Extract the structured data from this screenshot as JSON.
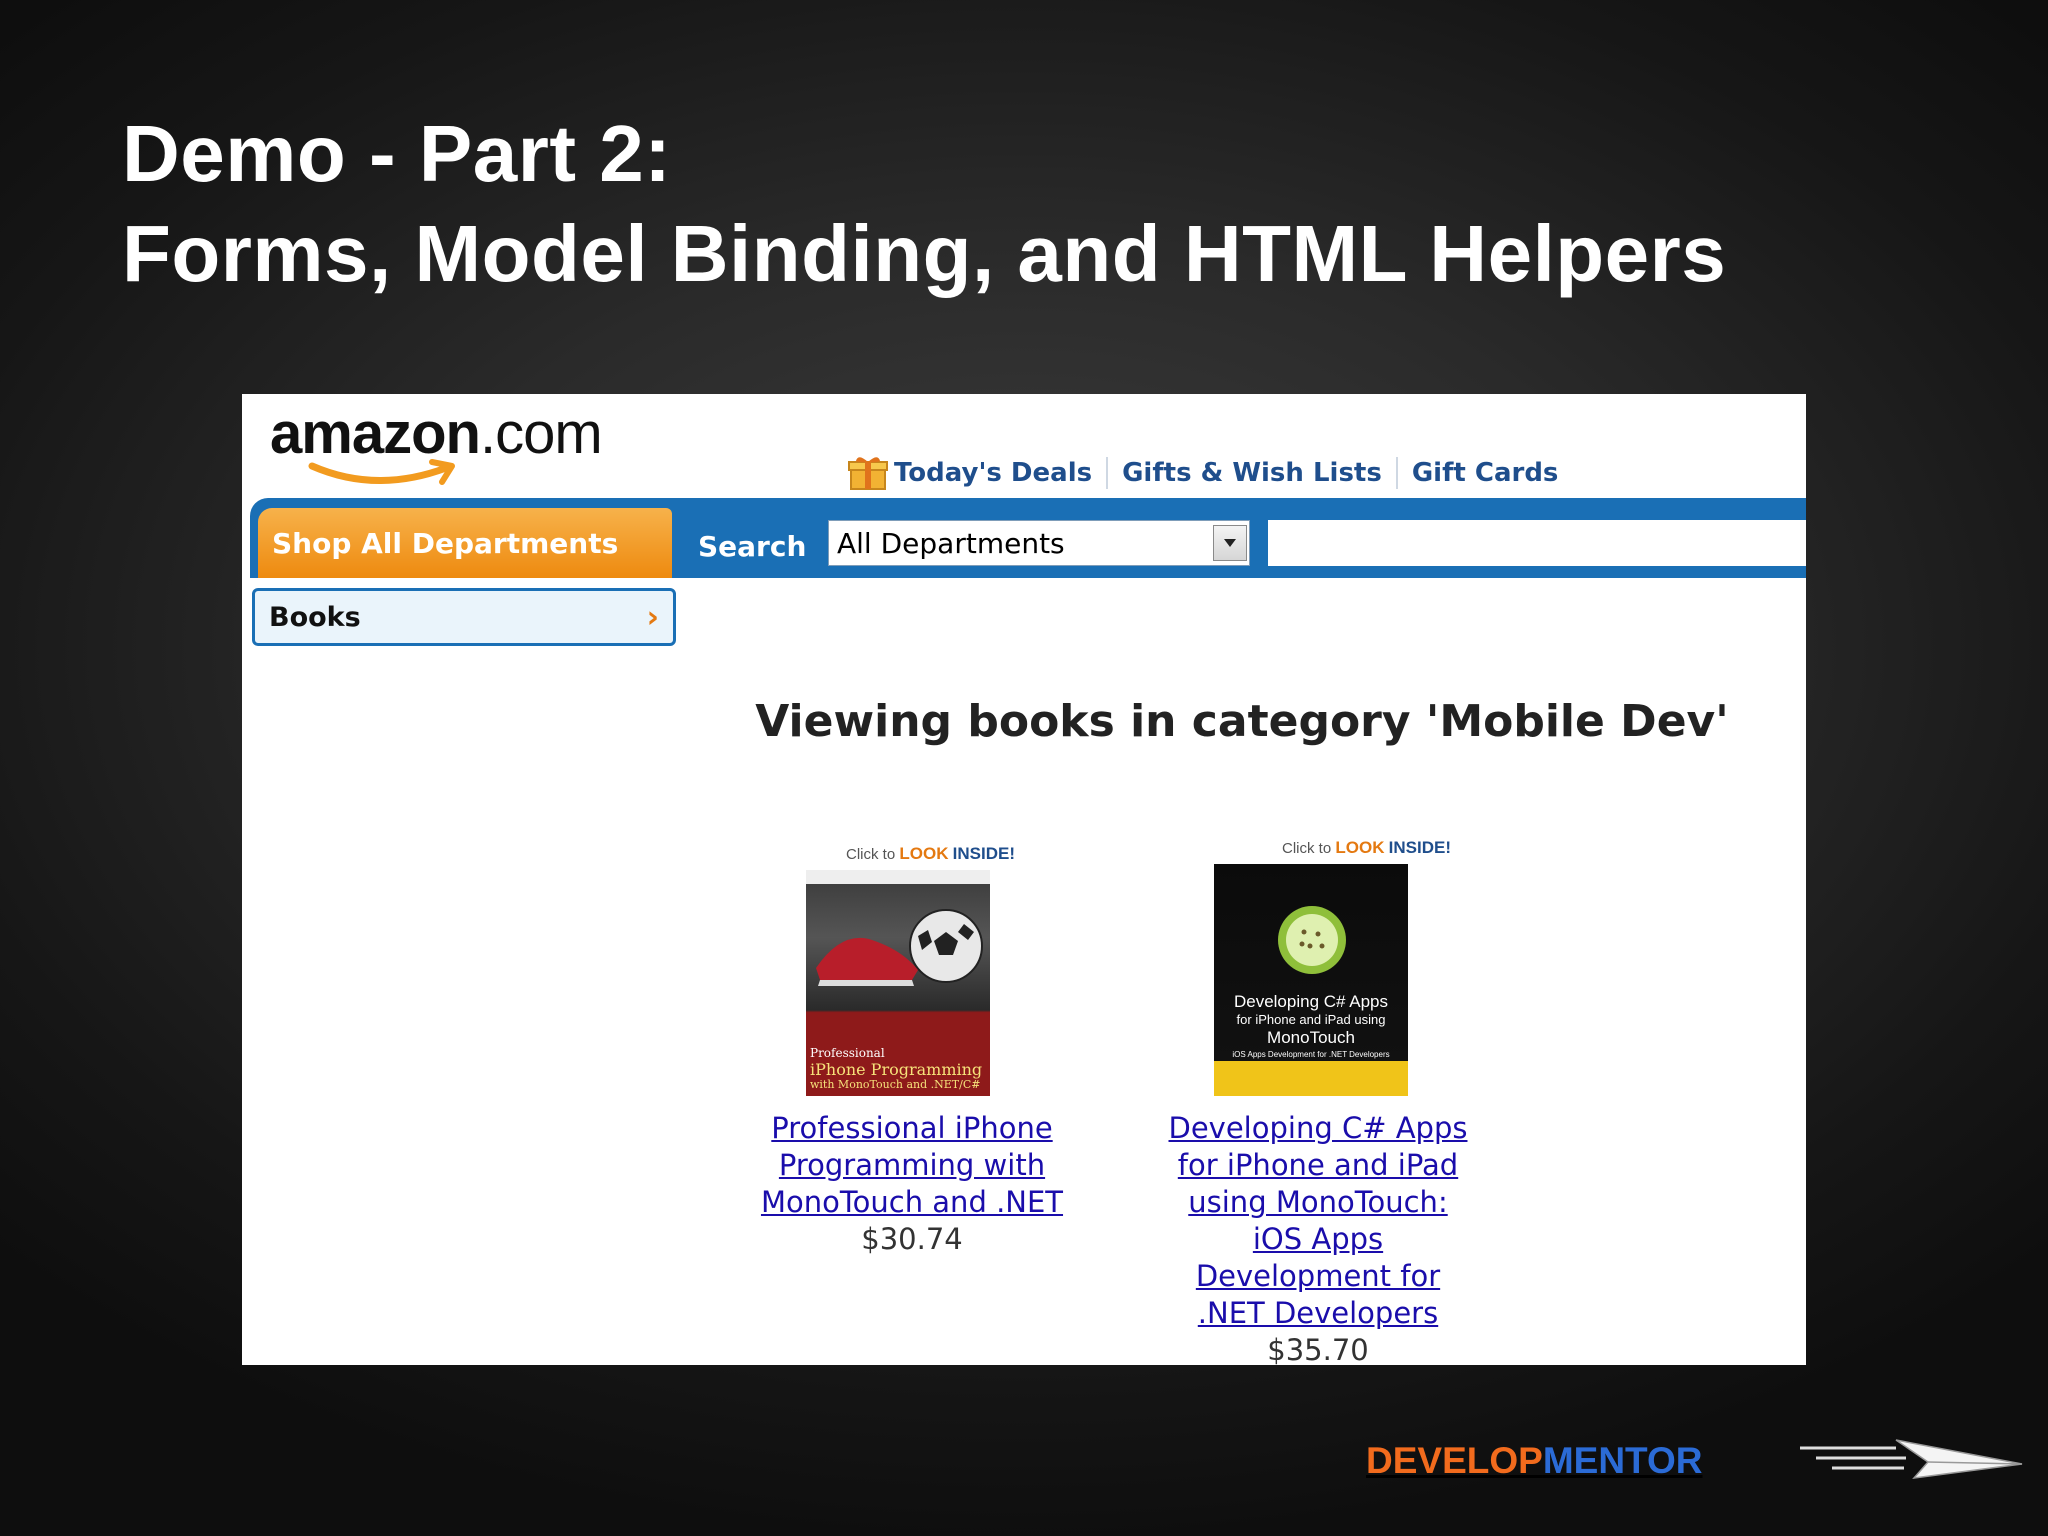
{
  "slide": {
    "title_line1": "Demo - Part 2:",
    "title_line2": "Forms, Model Binding, and HTML Helpers"
  },
  "amazon": {
    "logo_text": "amazon",
    "logo_suffix": ".com",
    "top_links": [
      "Today's Deals",
      "Gifts & Wish Lists",
      "Gift Cards"
    ],
    "shop_all_label": "Shop All Departments",
    "search_label": "Search",
    "department_selected": "All Departments",
    "search_value": "",
    "sidebar_item": "Books",
    "heading": "Viewing books in category 'Mobile Dev'",
    "look_inside": {
      "prefix": "Click to",
      "look": "LOOK",
      "inside": "INSIDE!"
    },
    "products": [
      {
        "title_lines": [
          "Professional iPhone",
          "Programming with",
          "MonoTouch and .NET"
        ],
        "price": "$30.74",
        "cover_lines": [
          "Professional",
          "iPhone Programming",
          "with MonoTouch and .NET/C#"
        ]
      },
      {
        "title_lines": [
          "Developing C# Apps",
          "for iPhone and iPad",
          "using MonoTouch:",
          "iOS Apps",
          "Development for",
          ".NET Developers"
        ],
        "price": "$35.70",
        "cover_lines": [
          "Developing C# Apps",
          "for iPhone and iPad using",
          "MonoTouch",
          "iOS Apps Development for .NET Developers"
        ]
      }
    ]
  },
  "footer": {
    "brand_part1": "DEVELOP",
    "brand_part2": "MENTOR"
  },
  "colors": {
    "nav_blue": "#1a6fb5",
    "shop_orange": "#ee8a0f",
    "link_blue": "#1a0dab",
    "brand_orange": "#f26b1d",
    "brand_blue": "#2b6bd6"
  }
}
